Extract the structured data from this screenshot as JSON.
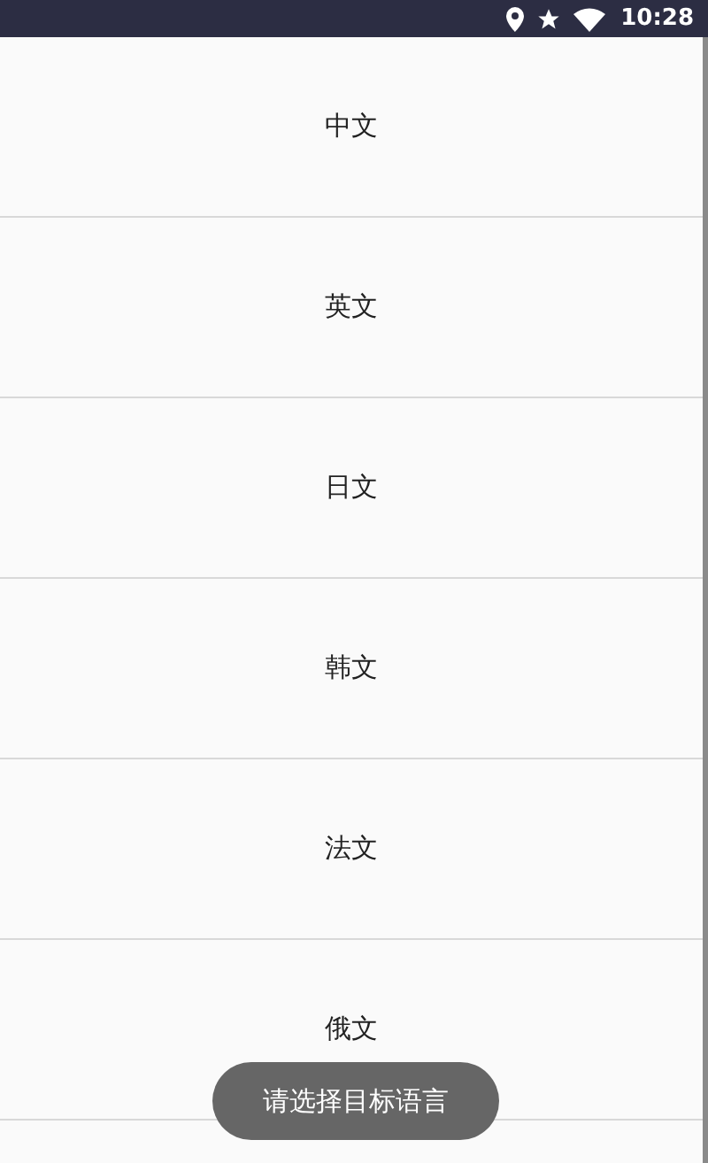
{
  "status_bar": {
    "time": "10:28"
  },
  "languages": [
    {
      "label": "中文"
    },
    {
      "label": "英文"
    },
    {
      "label": "日文"
    },
    {
      "label": "韩文"
    },
    {
      "label": "法文"
    },
    {
      "label": "俄文"
    }
  ],
  "toast": "请选择目标语言"
}
